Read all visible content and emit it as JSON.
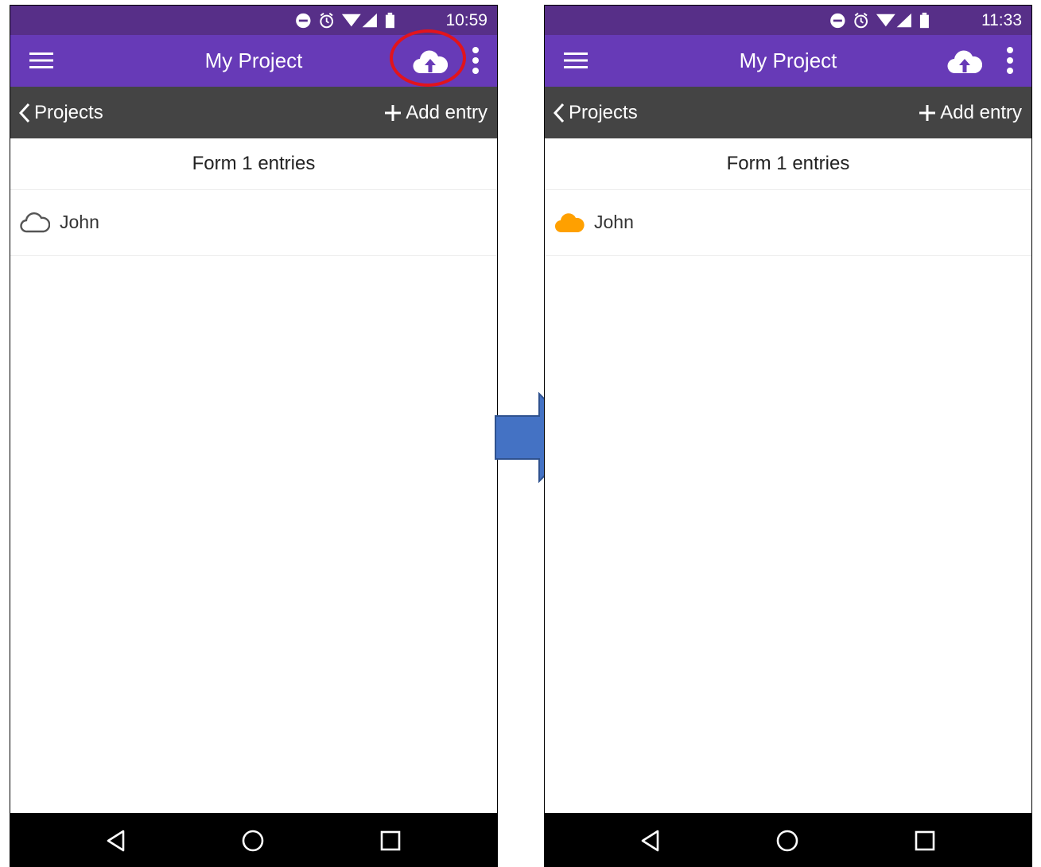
{
  "screens": [
    {
      "status_time": "10:59",
      "app_title": "My Project",
      "back_label": "Projects",
      "add_label": "Add entry",
      "list_header": "Form 1 entries",
      "entries": [
        {
          "name": "John",
          "sync_state": "unsynced",
          "icon": "cloud-outline-icon"
        }
      ]
    },
    {
      "status_time": "11:33",
      "app_title": "My Project",
      "back_label": "Projects",
      "add_label": "Add entry",
      "list_header": "Form 1 entries",
      "entries": [
        {
          "name": "John",
          "sync_state": "synced",
          "icon": "cloud-filled-icon"
        }
      ]
    }
  ],
  "colors": {
    "status_bar": "#572f88",
    "app_bar": "#673ab7",
    "nav_bar": "#444444",
    "synced_cloud": "#ffa000",
    "highlight": "#e2141c",
    "arrow": "#4472c4"
  },
  "highlight_target": "upload-button"
}
